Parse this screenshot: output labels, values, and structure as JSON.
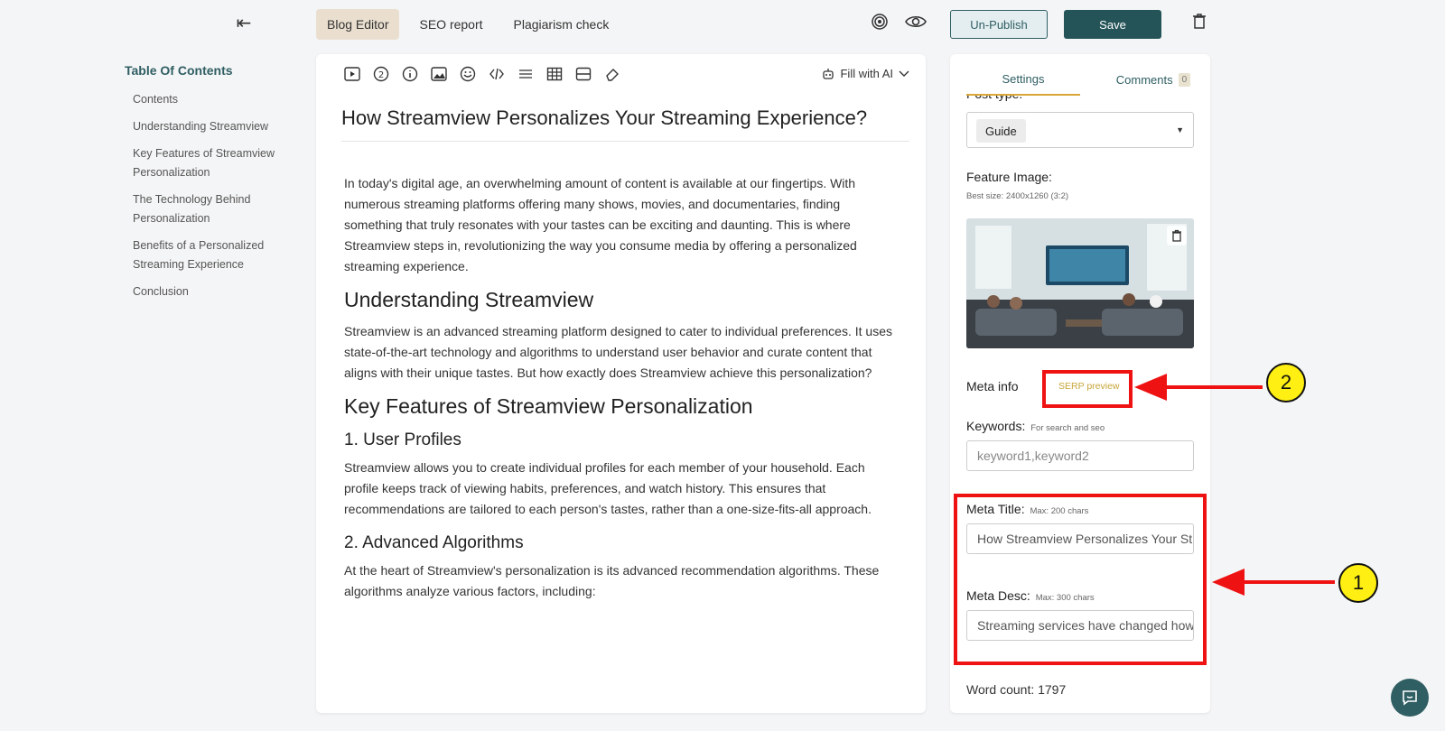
{
  "topbar": {
    "tabs": [
      {
        "label": "Blog Editor",
        "active": true
      },
      {
        "label": "SEO report",
        "active": false
      },
      {
        "label": "Plagiarism check",
        "active": false
      }
    ],
    "unpublish_label": "Un-Publish",
    "save_label": "Save"
  },
  "toc": {
    "title": "Table Of Contents",
    "items": [
      "Contents",
      "Understanding Streamview",
      "Key Features of Streamview Personalization",
      "The Technology Behind Personalization",
      "Benefits of a Personalized Streaming Experience",
      "Conclusion"
    ]
  },
  "editor": {
    "fill_ai_label": "Fill with AI",
    "title": "How Streamview Personalizes Your Streaming Experience?",
    "intro": "In today's digital age, an overwhelming amount of content is available at our fingertips. With numerous streaming platforms offering many shows, movies, and documentaries, finding something that truly resonates with your tastes can be exciting and daunting. This is where Streamview steps in, revolutionizing the way you consume media by offering a personalized streaming experience.",
    "h_understanding": "Understanding Streamview",
    "p_understanding": "Streamview is an advanced streaming platform designed to cater to individual preferences. It uses state-of-the-art technology and algorithms to understand user behavior and curate content that aligns with their unique tastes. But how exactly does Streamview achieve this personalization?",
    "h_features": "Key Features of Streamview Personalization",
    "h_profiles": "1. User Profiles",
    "p_profiles": "Streamview allows you to create individual profiles for each member of your household. Each profile keeps track of viewing habits, preferences, and watch history. This ensures that recommendations are tailored to each person's tastes, rather than a one-size-fits-all approach.",
    "h_algorithms": "2. Advanced Algorithms",
    "p_algorithms": "At the heart of Streamview's personalization is its advanced recommendation algorithms. These algorithms analyze various factors, including:"
  },
  "panel": {
    "tab_settings": "Settings",
    "tab_comments": "Comments",
    "comments_count": "0",
    "post_type_label": "Post type:",
    "post_type_value": "Guide",
    "feature_image_label": "Feature Image:",
    "feature_image_hint": "Best size: 2400x1260 (3:2)",
    "meta_info_label": "Meta info",
    "serp_preview_label": "SERP preview",
    "keywords_label": "Keywords:",
    "keywords_hint": "For search and seo",
    "keywords_placeholder": "keyword1,keyword2",
    "meta_title_label": "Meta Title:",
    "meta_title_hint": "Max: 200 chars",
    "meta_title_value": "How Streamview Personalizes Your Streaming Experience?",
    "meta_desc_label": "Meta Desc:",
    "meta_desc_hint": "Max: 300 chars",
    "meta_desc_value": "Streaming services have changed how we watch",
    "word_count": "Word count: 1797"
  },
  "annotations": {
    "marker_1": "1",
    "marker_2": "2",
    "color": "#ee1212"
  },
  "icons": [
    "collapse-icon",
    "target-icon",
    "eye-icon",
    "trash-icon",
    "video-icon",
    "number-icon",
    "info-icon",
    "image-icon",
    "emoji-icon",
    "code-icon",
    "divider-icon",
    "table-icon",
    "layout-icon",
    "eraser-icon",
    "robot-icon",
    "chevron-down-icon",
    "chat-icon"
  ]
}
